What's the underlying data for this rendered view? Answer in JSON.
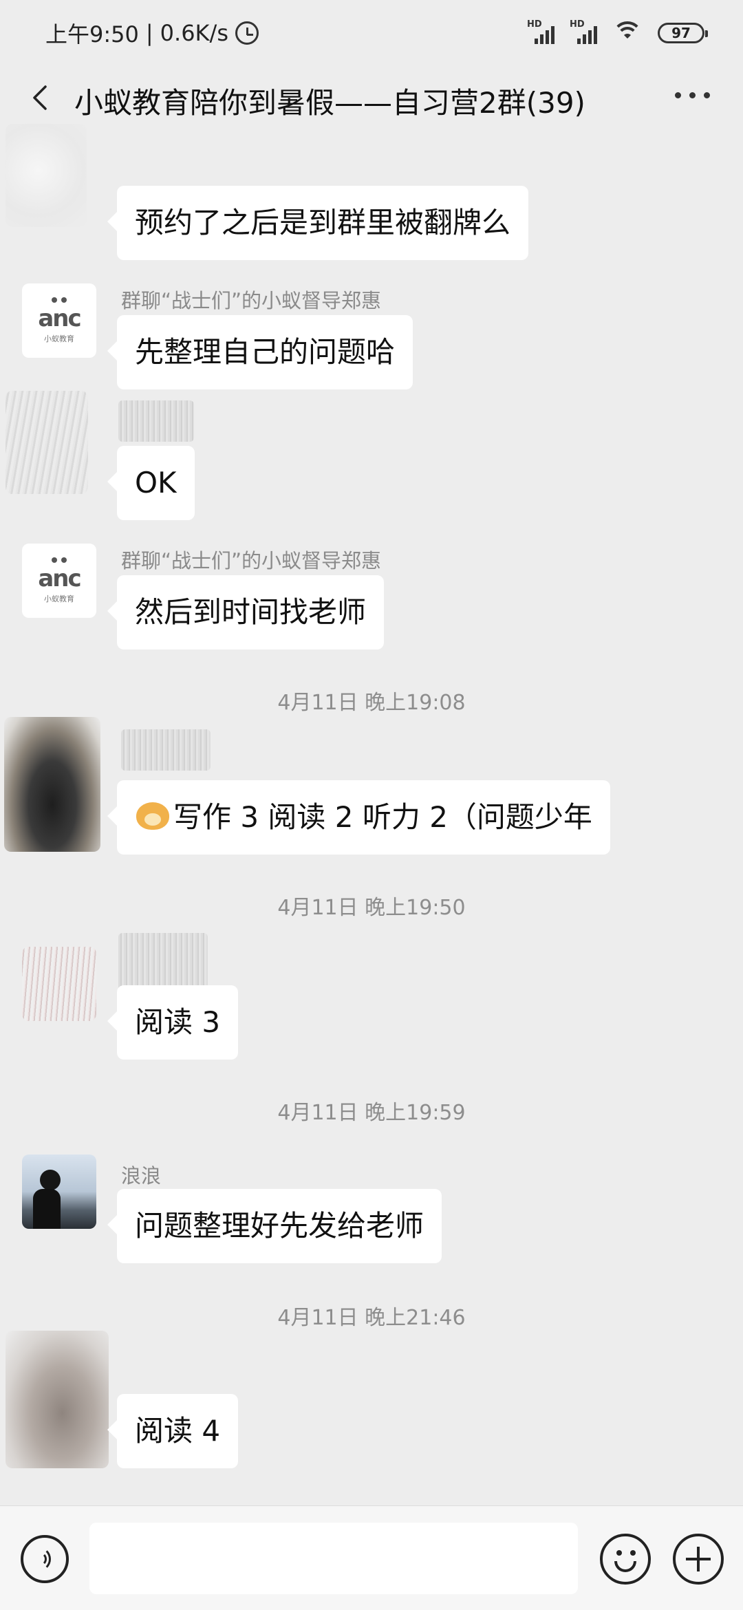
{
  "status_bar": {
    "time": "上午9:50",
    "speed": "0.6K/s",
    "signal_label_1": "HD",
    "signal_label_2": "HD",
    "battery": "97"
  },
  "header": {
    "title": "小蚁教育陪你到暑假——自习营2群(39)"
  },
  "messages": [
    {
      "sender": "",
      "text": "预约了之后是到群里被翻牌么"
    },
    {
      "sender": "群聊“战士们”的小蚁督导郑惠",
      "text": "先整理自己的问题哈"
    },
    {
      "sender": "",
      "text": "OK"
    },
    {
      "sender": "群聊“战士们”的小蚁督导郑惠",
      "text": "然后到时间找老师"
    },
    {
      "time": "4月11日 晚上19:08"
    },
    {
      "sender": "",
      "text": "写作 3 阅读 2 听力 2（问题少年",
      "emoji": "doge-emoji"
    },
    {
      "time": "4月11日 晚上19:50"
    },
    {
      "sender": "",
      "text": "阅读 3"
    },
    {
      "time": "4月11日 晚上19:59"
    },
    {
      "sender": "浪浪",
      "text": "问题整理好先发给老师"
    },
    {
      "time": "4月11日 晚上21:46"
    },
    {
      "sender": "",
      "text": "阅读 4"
    }
  ],
  "logo": {
    "mark": "anc",
    "sub": "小蚁教育"
  },
  "input_bar": {
    "text": "",
    "icons": [
      "voice-icon",
      "emoji-icon",
      "plus-icon"
    ]
  }
}
